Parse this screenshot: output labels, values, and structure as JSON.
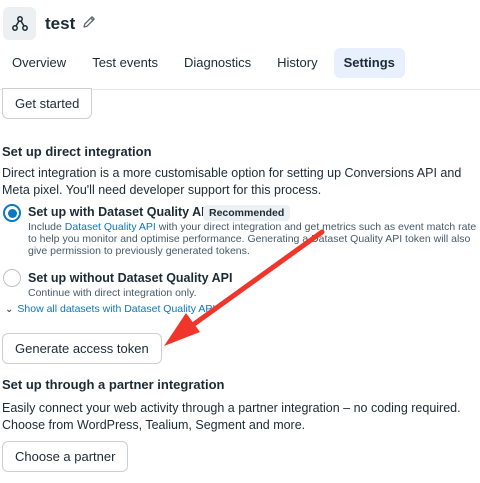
{
  "header": {
    "title": "test",
    "tabs": [
      {
        "label": "Overview",
        "active": false
      },
      {
        "label": "Test events",
        "active": false
      },
      {
        "label": "Diagnostics",
        "active": false
      },
      {
        "label": "History",
        "active": false
      },
      {
        "label": "Settings",
        "active": true
      }
    ],
    "icons": {
      "app": "pixel-network-icon",
      "edit": "pencil-icon"
    }
  },
  "get_started": {
    "label": "Get started"
  },
  "direct_integration": {
    "heading": "Set up direct integration",
    "description": "Direct integration is a more customisable option for setting up Conversions API and Meta pixel. You'll need developer support for this process.",
    "option_with": {
      "label": "Set up with Dataset Quality API",
      "badge": "Recommended",
      "desc_prefix": "Include ",
      "desc_link": "Dataset Quality API",
      "desc_rest": " with your direct integration and get metrics such as event match rate to help you monitor and optimise performance. Generating a Dataset Quality API token will also give permission to previously generated tokens.",
      "selected": true
    },
    "option_without": {
      "label": "Set up without Dataset Quality API",
      "desc": "Continue with direct integration only.",
      "selected": false
    },
    "show_all_link": "Show all datasets with Dataset Quality API",
    "generate_button": "Generate access token"
  },
  "partner_integration": {
    "heading": "Set up through a partner integration",
    "description": "Easily connect your web activity through a partner integration – no coding required. Choose from WordPress, Tealium, Segment and more.",
    "button": "Choose a partner"
  },
  "colors": {
    "accent": "#0a78be",
    "active_tab_bg": "#e7f0fc",
    "annotation_arrow": "#f0362a"
  }
}
